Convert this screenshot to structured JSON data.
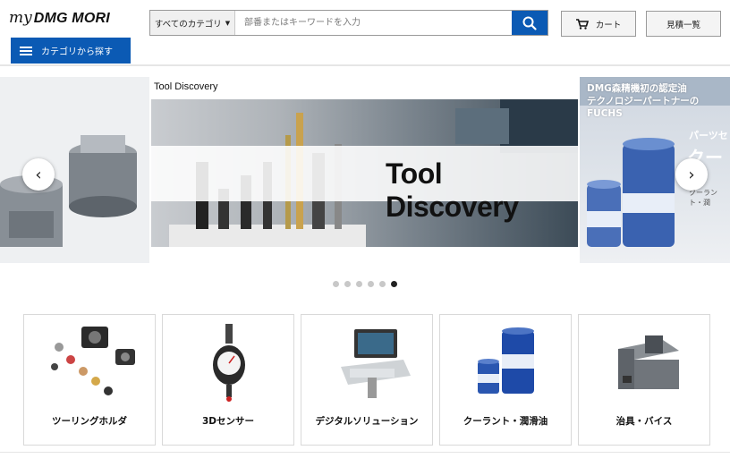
{
  "header": {
    "logo_my": "my",
    "logo_brand": "DMG MORI",
    "category_button_label": "カテゴリから探す",
    "search": {
      "category_label": "すべてのカテゴリ",
      "placeholder": "部番またはキーワードを入力",
      "value": ""
    },
    "cart_label": "カート",
    "quote_label": "見積一覧"
  },
  "carousel": {
    "main_title": "Tool Discovery",
    "main_banner_text": "Tool Discovery",
    "next_slide_title_line1": "DMG森精機初の認定油",
    "next_slide_title_line2": "テクノロジーパートナーのFUCHS",
    "next_slide_sub1": "パーツセ",
    "next_slide_sub2": "クー",
    "next_slide_note": "クーラント・潤",
    "prev_label": "‹",
    "next_label": "›",
    "dot_count": 6,
    "active_dot": 5
  },
  "categories": [
    {
      "label": "ツーリングホルダ",
      "icon": "tool-holder-icon"
    },
    {
      "label": "3Dセンサー",
      "icon": "3d-sensor-icon"
    },
    {
      "label": "デジタルソリューション",
      "icon": "digital-panel-icon"
    },
    {
      "label": "クーラント・潤滑油",
      "icon": "coolant-drum-icon"
    },
    {
      "label": "治具・バイス",
      "icon": "vise-icon"
    }
  ],
  "colors": {
    "accent": "#0b5ab4",
    "border": "#9a9a9a",
    "dot_inactive": "#c8c8c8",
    "dot_active": "#222222"
  }
}
